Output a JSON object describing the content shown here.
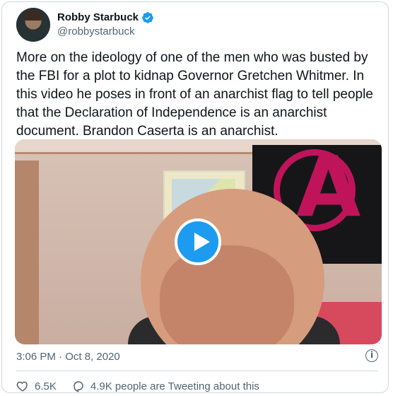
{
  "author": {
    "display_name": "Robby Starbuck",
    "handle": "@robbystarbuck",
    "verified_icon": "verified-badge-icon"
  },
  "tweet": {
    "text": "More on the ideology of one of the men who was busted by the FBI for a plot to kidnap Governor Gretchen Whitmer. In this video he poses in front of an anarchist flag to tell people that the Declaration of Independence is an anarchist document. Brandon Caserta is an anarchist.",
    "timestamp": "3:06 PM · Oct 8, 2020"
  },
  "media": {
    "type": "video",
    "play_icon": "play-icon"
  },
  "actions": {
    "likes": "6.5K",
    "tweeting": "4.9K people are Tweeting about this"
  },
  "colors": {
    "accent": "#1d9bf0",
    "text": "#0f1419",
    "muted": "#536471",
    "flag_symbol": "#c0145a"
  }
}
